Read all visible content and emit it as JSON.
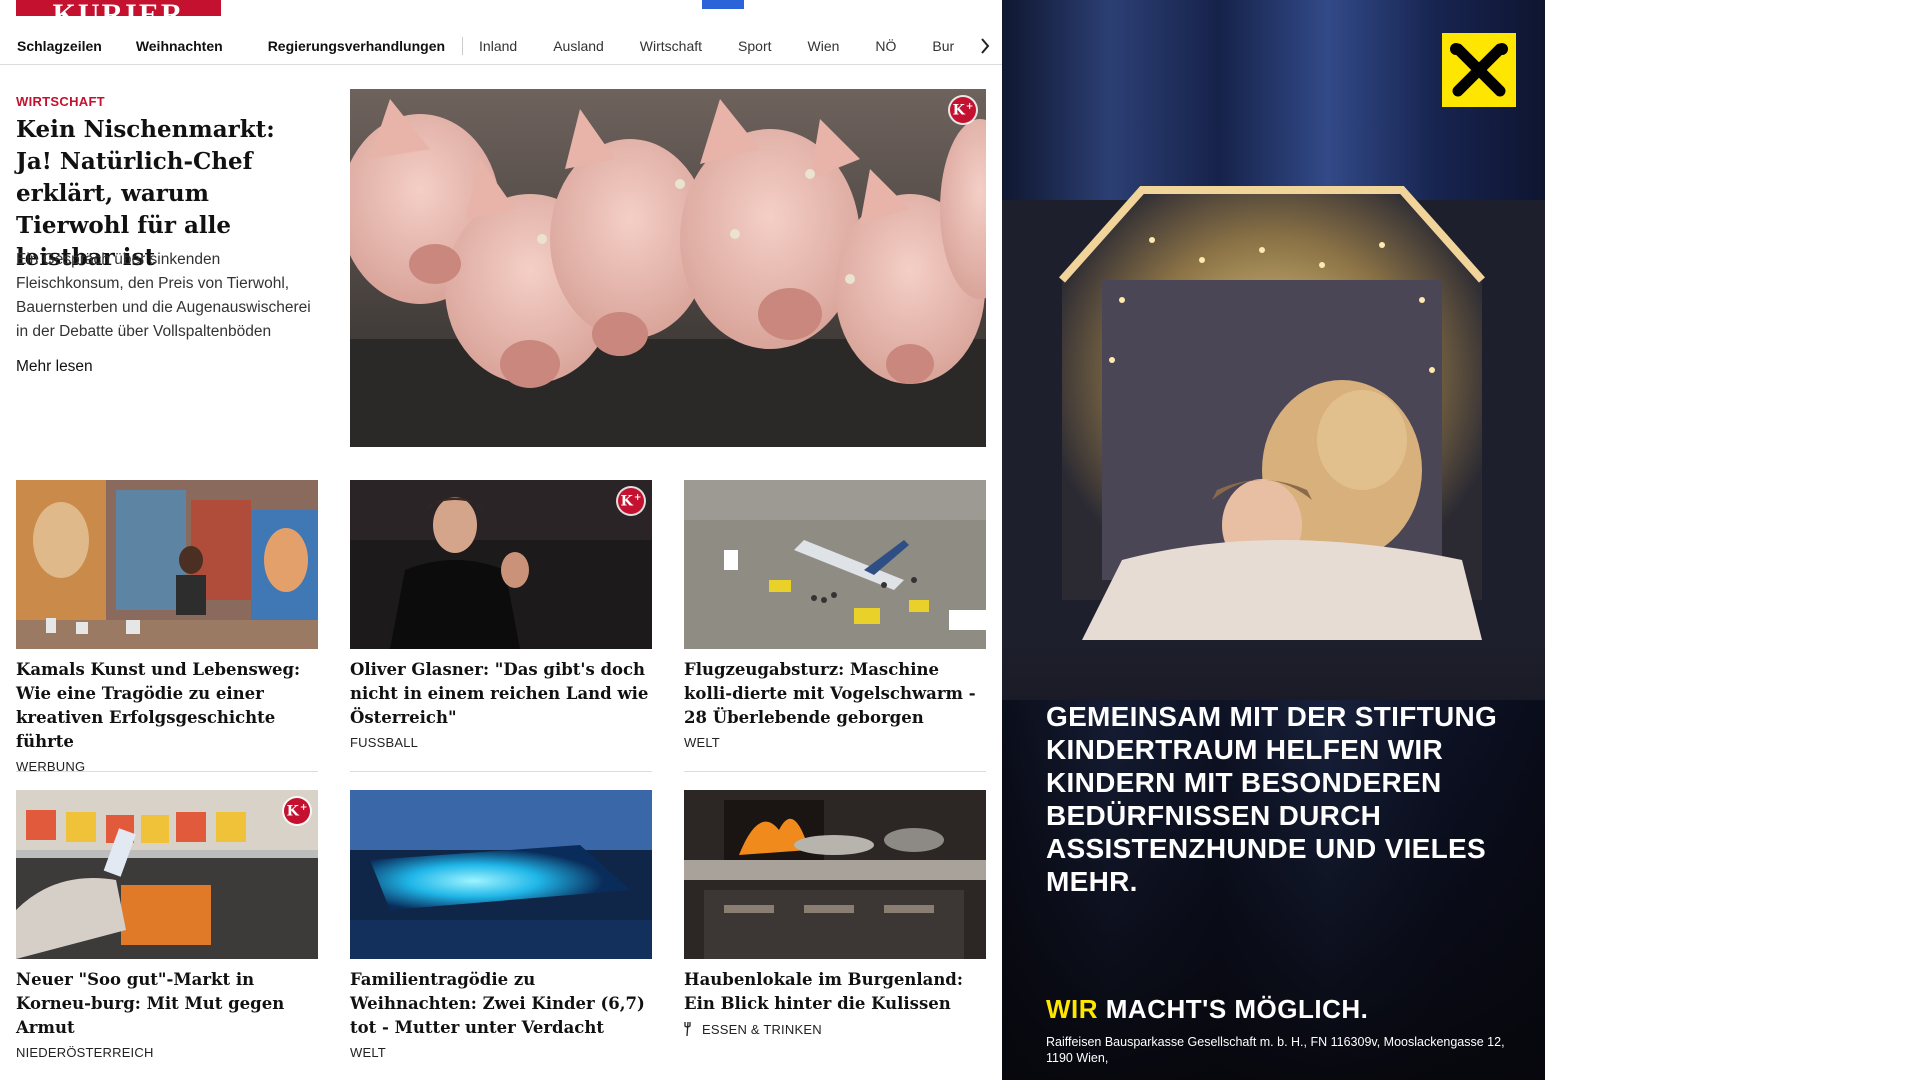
{
  "brand": {
    "logo_text": "KURIER"
  },
  "nav": {
    "items": [
      {
        "label": "Schlagzeilen",
        "bold": true
      },
      {
        "label": "Weihnachten",
        "bold": true
      },
      {
        "label": "Regierungsverhandlungen",
        "bold": true
      },
      {
        "label": "Inland",
        "bold": false
      },
      {
        "label": "Ausland",
        "bold": false
      },
      {
        "label": "Wirtschaft",
        "bold": false
      },
      {
        "label": "Sport",
        "bold": false
      },
      {
        "label": "Wien",
        "bold": false
      },
      {
        "label": "NÖ",
        "bold": false
      },
      {
        "label": "Bur",
        "bold": false
      }
    ],
    "next_icon": "chevron-right-icon"
  },
  "hero": {
    "category": "WIRTSCHAFT",
    "title": "Kein Nischenmarkt: Ja! Natürlich-Chef erklärt, warum Tierwohl für alle leistbar ist",
    "teaser": "Ein Gespräch über sinkenden Fleischkonsum, den Preis von Tierwohl, Bauernsterben und die Augenauswischerei in der Debatte über Vollspaltenböden",
    "more": "Mehr lesen",
    "badge": "K+"
  },
  "articles": [
    {
      "title": "Kamals Kunst und Lebensweg: Wie eine Tragödie zu einer kreativen Erfolgsgeschichte führte",
      "category": "Werbung",
      "badge": ""
    },
    {
      "title": "Oliver Glasner: \"Das gibt's doch nicht in einem reichen Land wie Österreich\"",
      "category": "Fussball",
      "badge": "K+"
    },
    {
      "title": "Flugzeugabsturz: Maschine kolli-dierte mit Vogelschwarm - 28 Überlebende geborgen",
      "category": "Welt",
      "badge": ""
    },
    {
      "title": "Neuer \"Soo gut\"-Markt in Korneu-burg: Mit Mut gegen Armut",
      "category": "Niederösterreich",
      "badge": "K+"
    },
    {
      "title": "Familientragödie zu Weihnachten: Zwei Kinder (6,7) tot - Mutter unter Verdacht",
      "category": "Welt",
      "badge": ""
    },
    {
      "title": "Haubenlokale im Burgenland: Ein Blick hinter die Kulissen",
      "category": "Essen & Trinken",
      "badge": "",
      "icon": "fork-icon"
    }
  ],
  "ad": {
    "headline": "Gemeinsam mit der Stiftung Kindertraum helfen wir Kindern mit besonderen Bedürfnissen durch Assistenzhunde und vieles mehr.",
    "slogan_highlight": "WIR",
    "slogan_rest": " MACHT'S MÖGLICH.",
    "legal": "Raiffeisen Bausparkasse Gesellschaft m. b. H., FN 116309v, Mooslackengasse 12, 1190 Wien,",
    "logo_icon": "raiffeisen-gable-cross-icon",
    "colors": {
      "logo_bg": "#ffe600",
      "slogan_highlight": "#ffe600"
    }
  },
  "colors": {
    "brand_red": "#c4112f",
    "top_button": "#2b63d8"
  }
}
